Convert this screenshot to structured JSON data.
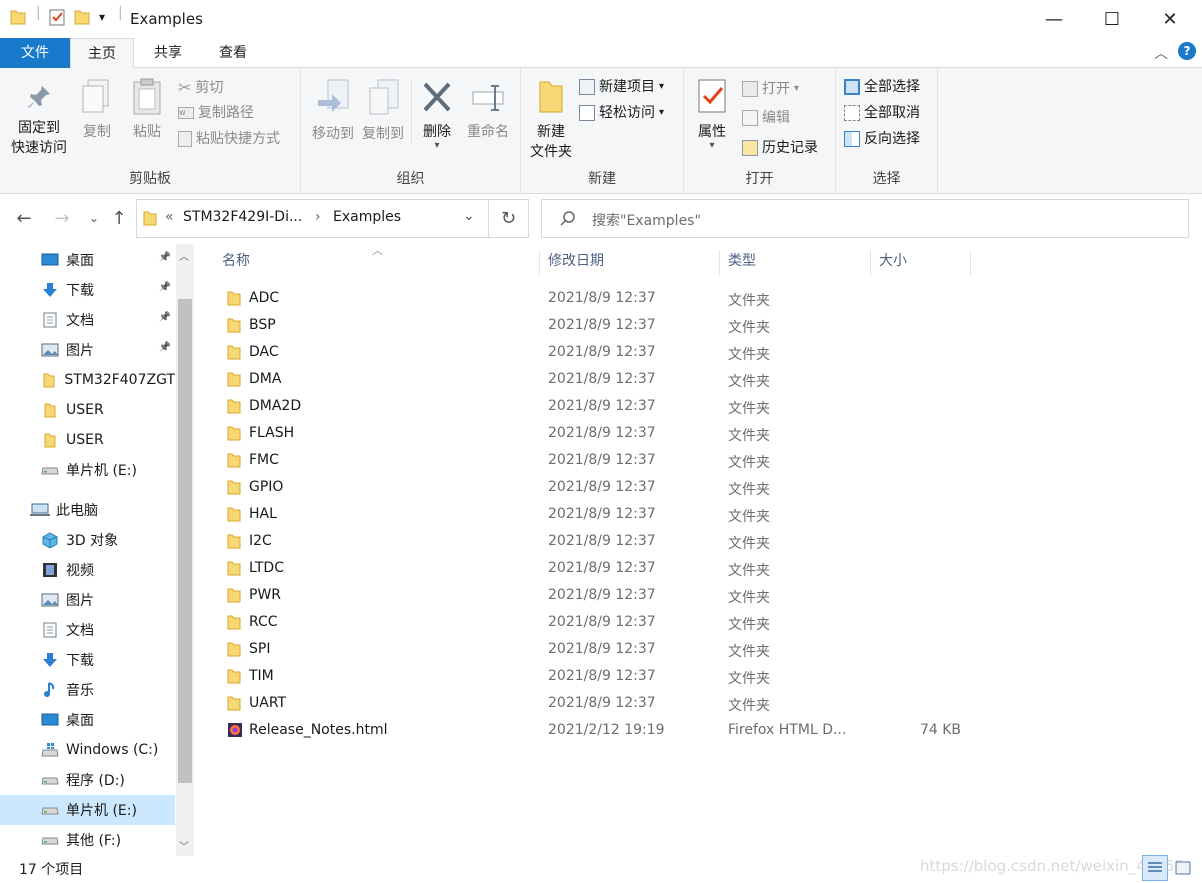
{
  "window": {
    "title": "Examples",
    "minimize_glyph": "—",
    "maximize_glyph": "☐",
    "close_glyph": "✕"
  },
  "ribbon_tabs": [
    "文件",
    "主页",
    "共享",
    "查看"
  ],
  "ribbon": {
    "clipboard": {
      "group_label": "剪贴板",
      "pin_line1": "固定到",
      "pin_line2": "快速访问",
      "copy": "复制",
      "paste": "粘贴",
      "cut": "剪切",
      "copy_path": "复制路径",
      "paste_shortcut": "粘贴快捷方式"
    },
    "organize": {
      "group_label": "组织",
      "move_to": "移动到",
      "copy_to": "复制到",
      "delete": "删除",
      "rename": "重命名"
    },
    "new": {
      "group_label": "新建",
      "new_folder_line1": "新建",
      "new_folder_line2": "文件夹",
      "new_item": "新建项目",
      "easy_access": "轻松访问"
    },
    "open": {
      "group_label": "打开",
      "properties": "属性",
      "open": "打开",
      "edit": "编辑",
      "history": "历史记录"
    },
    "select": {
      "group_label": "选择",
      "select_all": "全部选择",
      "select_none": "全部取消",
      "invert": "反向选择"
    }
  },
  "address": {
    "breadcrumb_prefix": "«",
    "crumb1": "STM32F429I-Di...",
    "crumb_sep": "›",
    "crumb2": "Examples",
    "search_placeholder": "搜索\"Examples\""
  },
  "nav_pane": [
    {
      "label": "桌面",
      "icon": "desktop-icon",
      "pinned": true
    },
    {
      "label": "下载",
      "icon": "download-icon",
      "pinned": true
    },
    {
      "label": "文档",
      "icon": "document-icon",
      "pinned": true
    },
    {
      "label": "图片",
      "icon": "picture-icon",
      "pinned": true
    },
    {
      "label": "STM32F407ZGT",
      "icon": "folder-icon",
      "pinned": false
    },
    {
      "label": "USER",
      "icon": "folder-icon",
      "pinned": false
    },
    {
      "label": "USER",
      "icon": "folder-icon",
      "pinned": false
    },
    {
      "label": "单片机 (E:)",
      "icon": "drive-icon",
      "pinned": false
    },
    {
      "label": "此电脑",
      "icon": "computer-icon",
      "pinned": false
    },
    {
      "label": "3D 对象",
      "icon": "3d-objects-icon",
      "pinned": false
    },
    {
      "label": "视频",
      "icon": "video-icon",
      "pinned": false
    },
    {
      "label": "图片",
      "icon": "picture-icon",
      "pinned": false
    },
    {
      "label": "文档",
      "icon": "document-icon",
      "pinned": false
    },
    {
      "label": "下载",
      "icon": "download-icon",
      "pinned": false
    },
    {
      "label": "音乐",
      "icon": "music-icon",
      "pinned": false
    },
    {
      "label": "桌面",
      "icon": "desktop-icon",
      "pinned": false
    },
    {
      "label": "Windows  (C:)",
      "icon": "windows-drive-icon",
      "pinned": false
    },
    {
      "label": "程序 (D:)",
      "icon": "drive-icon",
      "pinned": false
    },
    {
      "label": "单片机 (E:)",
      "icon": "drive-icon",
      "pinned": false,
      "selected": true
    },
    {
      "label": "其他 (F:)",
      "icon": "drive-icon",
      "pinned": false
    }
  ],
  "columns": {
    "name": "名称",
    "date": "修改日期",
    "type": "类型",
    "size": "大小"
  },
  "files": [
    {
      "name": "ADC",
      "date": "2021/8/9 12:37",
      "type": "文件夹",
      "size": ""
    },
    {
      "name": "BSP",
      "date": "2021/8/9 12:37",
      "type": "文件夹",
      "size": ""
    },
    {
      "name": "DAC",
      "date": "2021/8/9 12:37",
      "type": "文件夹",
      "size": ""
    },
    {
      "name": "DMA",
      "date": "2021/8/9 12:37",
      "type": "文件夹",
      "size": ""
    },
    {
      "name": "DMA2D",
      "date": "2021/8/9 12:37",
      "type": "文件夹",
      "size": ""
    },
    {
      "name": "FLASH",
      "date": "2021/8/9 12:37",
      "type": "文件夹",
      "size": ""
    },
    {
      "name": "FMC",
      "date": "2021/8/9 12:37",
      "type": "文件夹",
      "size": ""
    },
    {
      "name": "GPIO",
      "date": "2021/8/9 12:37",
      "type": "文件夹",
      "size": ""
    },
    {
      "name": "HAL",
      "date": "2021/8/9 12:37",
      "type": "文件夹",
      "size": ""
    },
    {
      "name": "I2C",
      "date": "2021/8/9 12:37",
      "type": "文件夹",
      "size": ""
    },
    {
      "name": "LTDC",
      "date": "2021/8/9 12:37",
      "type": "文件夹",
      "size": ""
    },
    {
      "name": "PWR",
      "date": "2021/8/9 12:37",
      "type": "文件夹",
      "size": ""
    },
    {
      "name": "RCC",
      "date": "2021/8/9 12:37",
      "type": "文件夹",
      "size": ""
    },
    {
      "name": "SPI",
      "date": "2021/8/9 12:37",
      "type": "文件夹",
      "size": ""
    },
    {
      "name": "TIM",
      "date": "2021/8/9 12:37",
      "type": "文件夹",
      "size": ""
    },
    {
      "name": "UART",
      "date": "2021/8/9 12:37",
      "type": "文件夹",
      "size": ""
    },
    {
      "name": "Release_Notes.html",
      "date": "2021/2/12 19:19",
      "type": "Firefox HTML D...",
      "size": "74 KB",
      "kind": "html"
    }
  ],
  "status": {
    "count": "17 个项目",
    "watermark": "https://blog.csdn.net/weixin_46255"
  },
  "colors": {
    "accent": "#1979ca",
    "selection": "#cce8ff",
    "folder": "#f8d775"
  }
}
